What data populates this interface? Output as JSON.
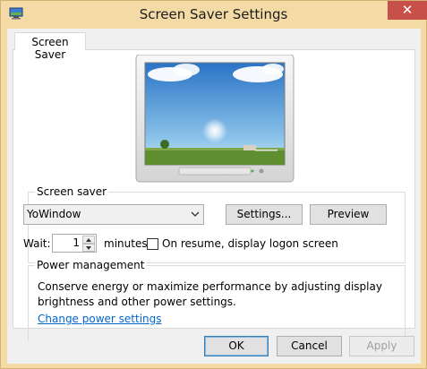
{
  "window": {
    "title": "Screen Saver Settings",
    "close_glyph": "✕"
  },
  "tabs": [
    {
      "label": "Screen Saver"
    }
  ],
  "screen_saver": {
    "group_label": "Screen saver",
    "selected": "YoWindow",
    "settings_label": "Settings...",
    "preview_label": "Preview",
    "wait_label": "Wait:",
    "wait_value": "1",
    "minutes_label": "minutes",
    "resume_label": "On resume, display logon screen",
    "resume_checked": false
  },
  "power_management": {
    "group_label": "Power management",
    "description": "Conserve energy or maximize performance by adjusting display brightness and other power settings.",
    "link_label": "Change power settings"
  },
  "footer": {
    "ok_label": "OK",
    "cancel_label": "Cancel",
    "apply_label": "Apply"
  },
  "icons": {
    "window_icon": "screen-saver-icon",
    "dropdown": "chevron-down-icon",
    "spin_up": "spin-up-icon",
    "spin_down": "spin-down-icon"
  },
  "colors": {
    "titlebar": "#f4dba6",
    "close_button": "#c7504a",
    "link": "#0066cc",
    "default_button_border": "#3c7fb1"
  }
}
